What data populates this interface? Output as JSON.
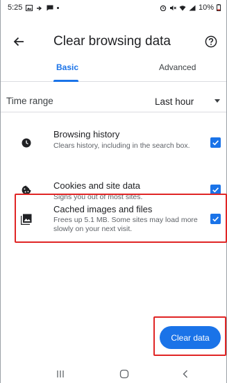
{
  "status_bar": {
    "time": "5:25",
    "battery": "10%"
  },
  "toolbar": {
    "title": "Clear browsing data"
  },
  "tabs": [
    {
      "label": "Basic",
      "selected": true
    },
    {
      "label": "Advanced",
      "selected": false
    }
  ],
  "time_range": {
    "label": "Time range",
    "value": "Last hour"
  },
  "options": [
    {
      "icon": "clock-icon",
      "title": "Browsing history",
      "description": "Clears history, including in the search box.",
      "checked": true
    },
    {
      "icon": "cookie-icon",
      "title": "Cookies and site data",
      "description": "Signs you out of most sites.",
      "checked": true
    },
    {
      "icon": "image-icon",
      "title": "Cached images and files",
      "description": "Frees up 5.1 MB. Some sites may load more slowly on your next visit.",
      "checked": true
    }
  ],
  "action": {
    "clear_label": "Clear data"
  },
  "colors": {
    "accent": "#1a73e8",
    "highlight": "#e02424"
  }
}
